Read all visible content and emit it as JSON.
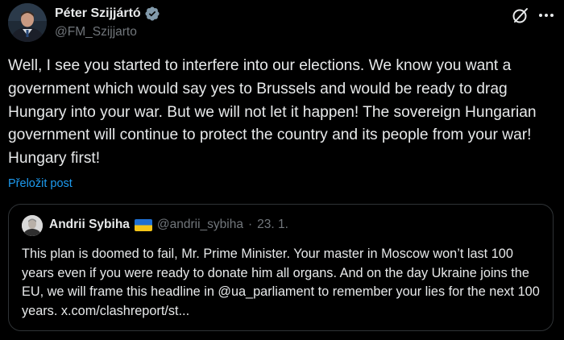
{
  "post": {
    "author": {
      "display_name": "Péter Szijjártó",
      "handle": "@FM_Szijjarto",
      "verified": true
    },
    "icons": {
      "grok": "grok-icon",
      "more": "more-options-icon",
      "verified": "verified-badge-icon"
    },
    "text": "Well, I see you started to interfere into our elections. We know you want a government which would say yes to Brussels and would be ready to drag Hungary into your war. But we will not let it happen! The sovereign Hungarian government will continue to protect the country and its people from your war! Hungary first!",
    "translate_label": "Přeložit post"
  },
  "quote": {
    "author": {
      "display_name": "Andrii Sybiha",
      "flag": "ukraine-flag",
      "handle": "@andrii_sybiha",
      "separator": "·",
      "date": "23. 1."
    },
    "text": "This plan is doomed to fail, Mr. Prime Minister. Your master in Moscow won’t last 100 years even if you were ready to donate him all organs. And on the day Ukraine joins the EU, we will frame this headline in @ua_parliament to remember your lies for the next 100 years. x.com/clashreport/st..."
  },
  "colors": {
    "background": "#000000",
    "text_primary": "#e7e9ea",
    "text_secondary": "#71767b",
    "link": "#1d9bf0",
    "border": "#2f3336",
    "verified_badge": "#829aab"
  }
}
